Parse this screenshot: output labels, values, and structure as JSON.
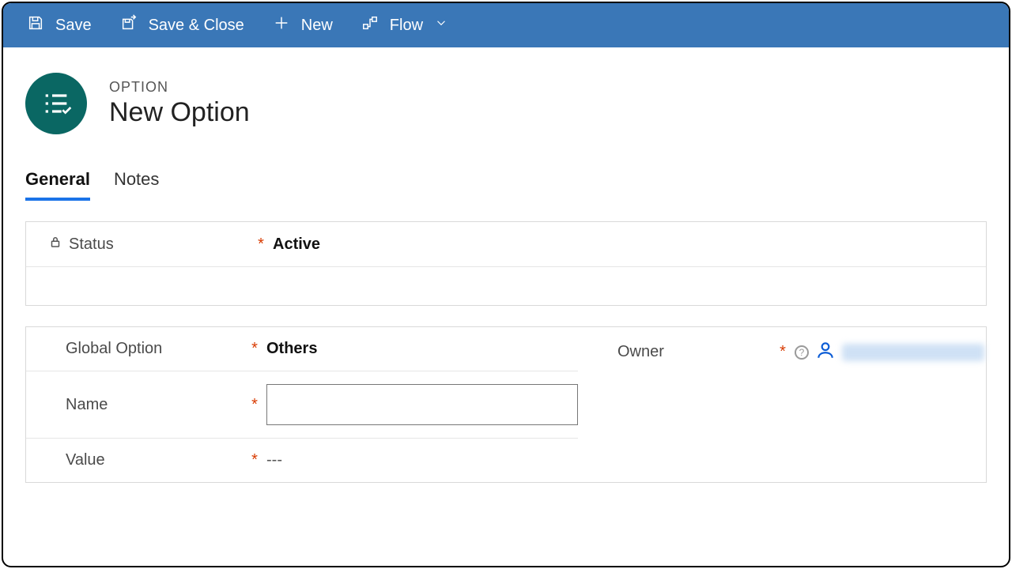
{
  "cmdbar": {
    "save": "Save",
    "saveClose": "Save & Close",
    "new": "New",
    "flow": "Flow"
  },
  "header": {
    "eyebrow": "OPTION",
    "title": "New Option"
  },
  "tabs": {
    "general": "General",
    "notes": "Notes"
  },
  "form": {
    "status": {
      "label": "Status",
      "value": "Active"
    },
    "globalOption": {
      "label": "Global Option",
      "value": "Others"
    },
    "name": {
      "label": "Name",
      "value": ""
    },
    "value": {
      "label": "Value",
      "value": "---"
    },
    "owner": {
      "label": "Owner"
    }
  }
}
